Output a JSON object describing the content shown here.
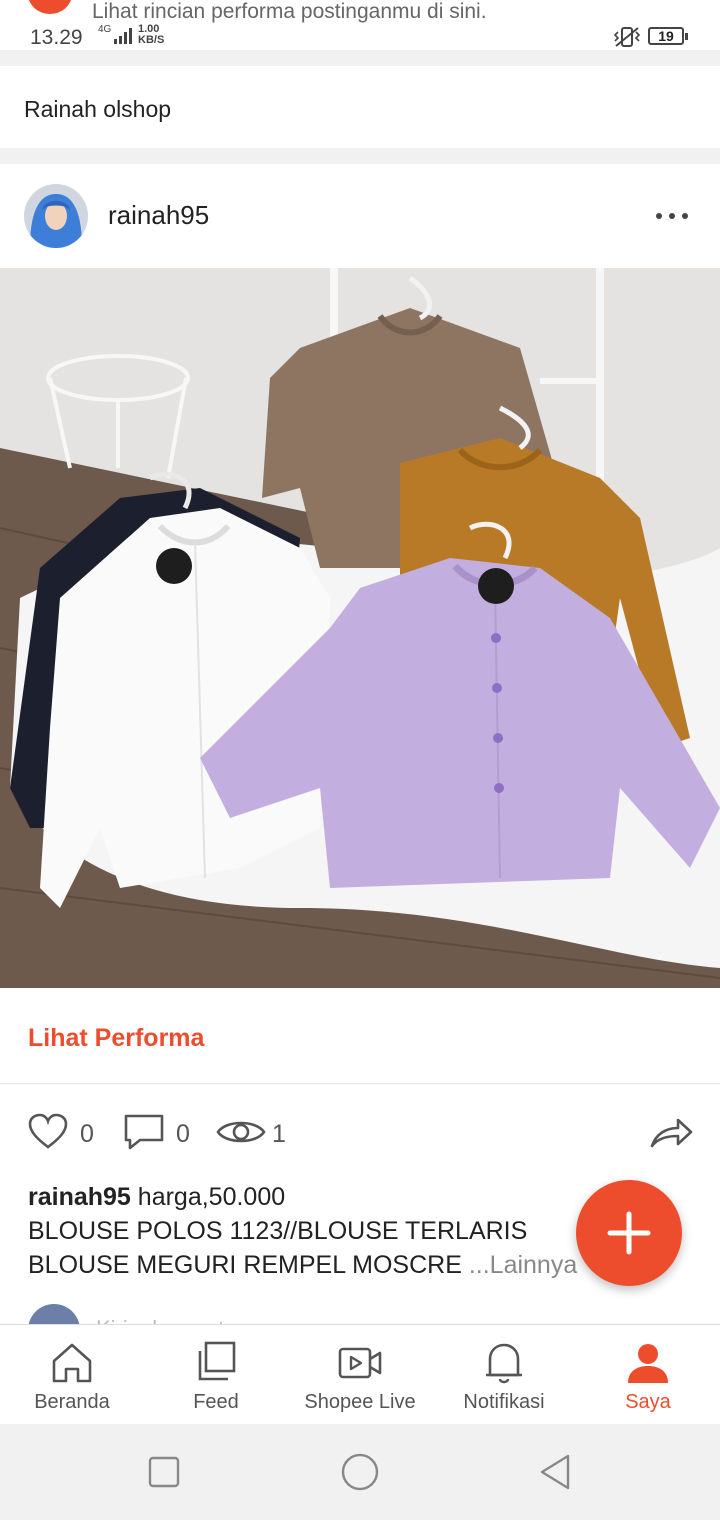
{
  "status_bar": {
    "notification_text": "Lihat rincian performa postinganmu di sini.",
    "time": "13.29",
    "network": "4G",
    "speed_value": "1.00",
    "speed_unit": "KB/S",
    "battery": "19"
  },
  "shop": {
    "name": "Rainah olshop"
  },
  "post": {
    "username": "rainah95",
    "image_description": "Five ruffle-collar blouses in brown, mustard, navy, white and lilac arranged on white hangers over a fur rug",
    "performance_link": "Lihat Performa",
    "likes": "0",
    "comments": "0",
    "views": "1",
    "caption_user": "rainah95",
    "caption_text": " harga,50.000\nBLOUSE POLOS 1123//BLOUSE TERLARIS\nBLOUSE MEGURI REMPEL MOSCRE ",
    "caption_more": "...Lainnya",
    "comment_peek": "Kirim komentar"
  },
  "icons": {
    "like": "heart-icon",
    "comment": "speech-bubble-icon",
    "views": "eye-icon",
    "share": "share-arrow-icon",
    "fab": "plus-icon"
  },
  "bottom_nav": {
    "items": [
      {
        "label": "Beranda",
        "icon": "home-icon",
        "active": false
      },
      {
        "label": "Feed",
        "icon": "feed-icon",
        "active": false
      },
      {
        "label": "Shopee Live",
        "icon": "live-video-icon",
        "active": false
      },
      {
        "label": "Notifikasi",
        "icon": "bell-icon",
        "active": false
      },
      {
        "label": "Saya",
        "icon": "person-icon",
        "active": true
      }
    ]
  },
  "colors": {
    "accent": "#ee4d2d",
    "text": "#222222",
    "muted": "#888888"
  }
}
